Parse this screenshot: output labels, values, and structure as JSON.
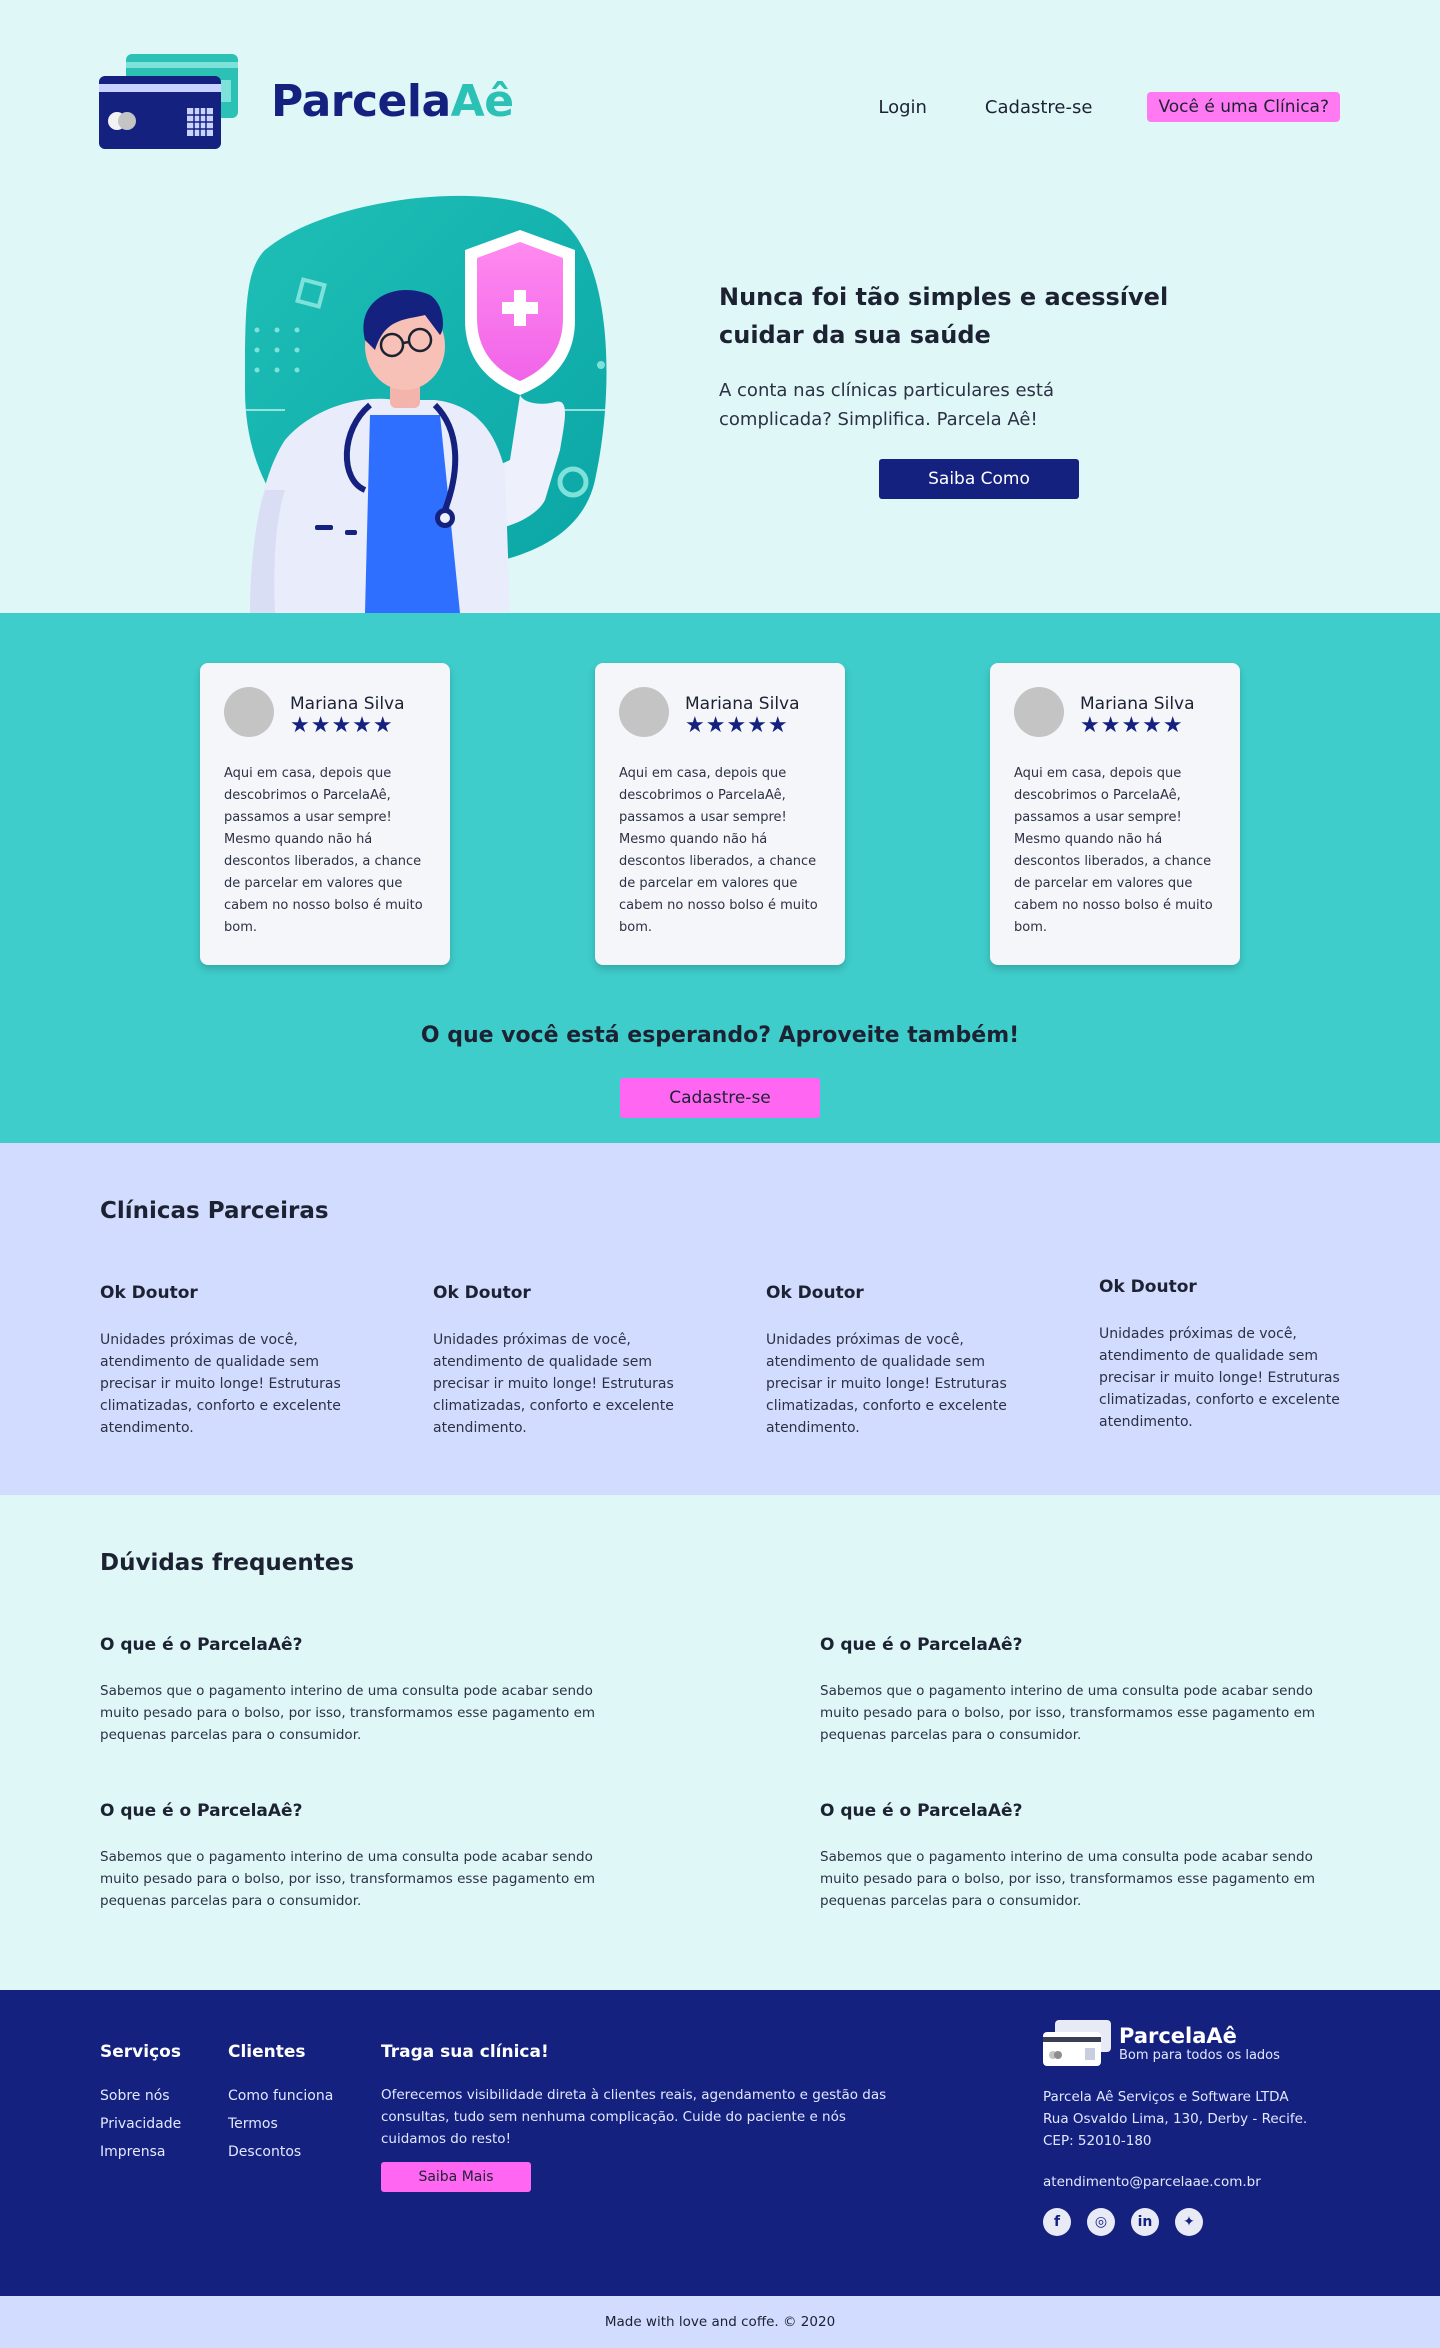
{
  "brand": {
    "part1": "Parcela",
    "part2": "Aê"
  },
  "nav": {
    "login": "Login",
    "signup": "Cadastre-se",
    "clinic": "Você é uma Clínica?"
  },
  "hero": {
    "title": "Nunca foi tão simples e acessível cuidar da sua saúde",
    "subtitle": "A conta nas clínicas particulares está complicada? Simplifica. Parcela Aê!",
    "button": "Saiba Como"
  },
  "testimonials": [
    {
      "name": "Mariana Silva",
      "stars": "★★★★★",
      "quote": "Aqui em casa, depois que descobrimos o ParcelaAê, passamos a usar sempre! Mesmo quando não há descontos liberados, a chance de parcelar em valores que cabem no nosso bolso é muito bom."
    },
    {
      "name": "Mariana Silva",
      "stars": "★★★★★",
      "quote": "Aqui em casa, depois que descobrimos o ParcelaAê, passamos a usar sempre! Mesmo quando não há descontos liberados, a chance de parcelar em valores que cabem no nosso bolso é muito bom."
    },
    {
      "name": "Mariana Silva",
      "stars": "★★★★★",
      "quote": "Aqui em casa, depois que descobrimos o ParcelaAê, passamos a usar sempre! Mesmo quando não há descontos liberados, a chance de parcelar em valores que cabem no nosso bolso é muito bom."
    }
  ],
  "rating": 5,
  "cta": {
    "title": "O que você está esperando? Aproveite também!",
    "button": "Cadastre-se"
  },
  "clinics": {
    "title": "Clínicas Parceiras",
    "items": [
      {
        "name": "Ok Doutor",
        "desc": "Unidades próximas de você, atendimento de qualidade sem precisar ir muito longe! Estruturas climatizadas, conforto e excelente atendimento."
      },
      {
        "name": "Ok Doutor",
        "desc": "Unidades próximas de você, atendimento de qualidade sem precisar ir muito longe! Estruturas climatizadas, conforto e excelente atendimento."
      },
      {
        "name": "Ok Doutor",
        "desc": "Unidades próximas de você, atendimento de qualidade sem precisar ir muito longe! Estruturas climatizadas, conforto e excelente atendimento."
      },
      {
        "name": "Ok Doutor",
        "desc": "Unidades próximas de você, atendimento de qualidade sem precisar ir muito longe! Estruturas climatizadas, conforto e excelente atendimento."
      }
    ]
  },
  "faq": {
    "title": "Dúvidas frequentes",
    "items": [
      {
        "q": "O que é o ParcelaAê?",
        "a": "Sabemos que o pagamento interino de uma consulta pode acabar sendo muito pesado para o bolso, por isso, transformamos esse pagamento em pequenas parcelas para o consumidor."
      },
      {
        "q": "O que é o ParcelaAê?",
        "a": "Sabemos que o pagamento interino de uma consulta pode acabar sendo muito pesado para o bolso, por isso, transformamos esse pagamento em pequenas parcelas para o consumidor."
      },
      {
        "q": "O que é o ParcelaAê?",
        "a": "Sabemos que o pagamento interino de uma consulta pode acabar sendo muito pesado para o bolso, por isso, transformamos esse pagamento em pequenas parcelas para o consumidor."
      },
      {
        "q": "O que é o ParcelaAê?",
        "a": "Sabemos que o pagamento interino de uma consulta pode acabar sendo muito pesado para o bolso, por isso, transformamos esse pagamento em pequenas parcelas para o consumidor."
      }
    ]
  },
  "footer": {
    "services": {
      "title": "Serviços",
      "links": [
        "Sobre nós",
        "Privacidade",
        "Imprensa"
      ]
    },
    "clients": {
      "title": "Clientes",
      "links": [
        "Como funciona",
        "Termos",
        "Descontos"
      ]
    },
    "bring": {
      "title": "Traga sua clínica!",
      "text": "Oferecemos visibilidade direta à clientes reais, agendamento e gestão das consultas, tudo sem nenhuma complicação. Cuide do paciente e nós cuidamos do resto!",
      "button": "Saiba Mais"
    },
    "brand_name": "ParcelaAê",
    "tagline": "Bom para todos os lados",
    "company": "Parcela Aê Serviços e Software LTDA",
    "address": "Rua Osvaldo Lima, 130, Derby - Recife.",
    "cep": "CEP: 52010-180",
    "email": "atendimento@parcelaae.com.br",
    "socials": [
      {
        "icon": "facebook-icon",
        "glyph": "f"
      },
      {
        "icon": "instagram-icon",
        "glyph": "◎"
      },
      {
        "icon": "linkedin-icon",
        "glyph": "in"
      },
      {
        "icon": "twitter-icon",
        "glyph": "✦"
      }
    ]
  },
  "bottom_bar": "Made with love and coffe. © 2020",
  "colors": {
    "navy": "#14217f",
    "teal": "#3ecdcb",
    "light_teal": "#dff7f7",
    "lavender": "#d1dcfe",
    "pink": "#ff66f2"
  }
}
